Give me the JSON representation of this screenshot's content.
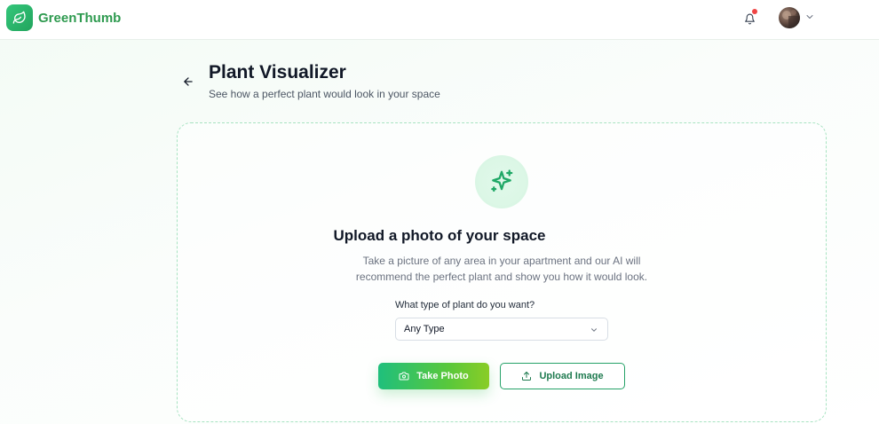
{
  "header": {
    "brand": "GreenThumb",
    "icons": {
      "logo": "leaf-icon",
      "notifications": "bell-icon",
      "avatar_caret": "chevron-down-icon"
    },
    "has_notification": true
  },
  "page": {
    "title": "Plant Visualizer",
    "subtitle": "See how a perfect plant would look in your space"
  },
  "upload": {
    "icon": "sparkles-icon",
    "title": "Upload a photo of your space",
    "description": "Take a picture of any area in your apartment and our AI will recommend the perfect plant and show you how it would look.",
    "select_label": "What type of plant do you want?",
    "select_value": "Any Type",
    "take_photo_label": "Take Photo",
    "upload_image_label": "Upload Image"
  },
  "colors": {
    "brand": "#2e9a4f",
    "accent": "#1fbf7c",
    "accent_end": "#8acd26",
    "notification_dot": "#ef4444",
    "dashed_border": "#a7e3c1"
  }
}
